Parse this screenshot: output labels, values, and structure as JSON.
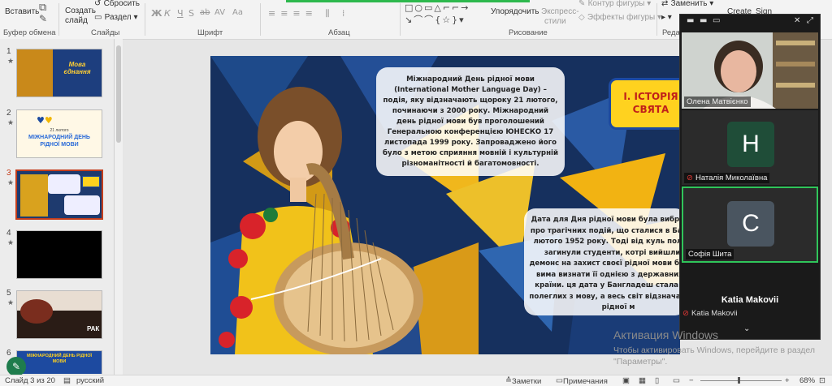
{
  "ribbon": {
    "clipboard": {
      "paste": "Вставить",
      "label": "Буфер обмена"
    },
    "slides": {
      "create": "Создать",
      "create2": "слайд",
      "reset": "Сбросить",
      "section": "Раздел",
      "label": "Слайды"
    },
    "font": {
      "label": "Шрифт",
      "buttons": [
        "Ж",
        "К",
        "Ч",
        "S",
        "ab",
        "AV",
        "Aa"
      ]
    },
    "paragraph": {
      "label": "Абзац"
    },
    "drawing": {
      "label": "Рисование",
      "arrange": "Упорядочить",
      "express": "Экспресс-",
      "express2": "стили",
      "outline": "Контур фигуры",
      "effects": "Эффекты фигуры"
    },
    "editing": {
      "replace": "Заменить",
      "label": "Реда"
    },
    "create_btn": "Create",
    "sign_btn": "Sign"
  },
  "thumbnails": [
    {
      "num": "1",
      "title": "Мова єднання"
    },
    {
      "num": "2",
      "title": "МІЖНАРОДНИЙ ДЕНЬ РІДНОЇ МОВИ",
      "date": "21 лютого"
    },
    {
      "num": "3",
      "title": ""
    },
    {
      "num": "4",
      "title": ""
    },
    {
      "num": "5",
      "title": "РАК"
    },
    {
      "num": "6",
      "title": "МІЖНАРОДНИЙ ДЕНЬ РІДНОЇ МОВИ"
    }
  ],
  "slide": {
    "badge": "І. ІСТОРІЯ СВЯТА",
    "text1": "Міжнародний День рідної мови (International Mother Language Day) – подія, яку відзначають щороку 21 лютого, починаючи з 2000 року. Міжнародний день рідної мови був проголошений Генеральною конференцією ЮНЕСКО 17 листопада 1999 року. Запроваджено його було з метою сприяння мовній і культурній різноманітності й багатомовності.",
    "text2": "Дата для Дня рідної мови була вибрана на про трагічних подій, що сталися в Банглад лютого 1952 року. Тоді від куль поліцейс загинули студенти, котрі вийшли на демонс на захист своєї рідної мови бенгалі, вима визнати її однією з державних мов країни. ця дата у Бангладеш стала днем полеглих з мову, а весь світ відзначає День рідної м"
  },
  "zoom": {
    "participants": [
      {
        "name": "Олена Матвієнко",
        "type": "video"
      },
      {
        "name": "Наталія Миколаївна",
        "initial": "Н",
        "color": "#1f4d38",
        "muted": true
      },
      {
        "name": "Софія Шита",
        "initial": "С",
        "color": "#4a5560",
        "muted": false,
        "active": true
      },
      {
        "name": "Katia Makovii",
        "muted": true
      }
    ],
    "katia_display": "Katia Makovii"
  },
  "watermark": {
    "title": "Активация Windows",
    "text": "Чтобы активировать Windows, перейдите в раздел \"Параметры\"."
  },
  "status": {
    "slide": "Слайд 3 из 20",
    "lang": "русский",
    "notes": "Заметки",
    "comments": "Примечания",
    "zoom": "68%"
  }
}
